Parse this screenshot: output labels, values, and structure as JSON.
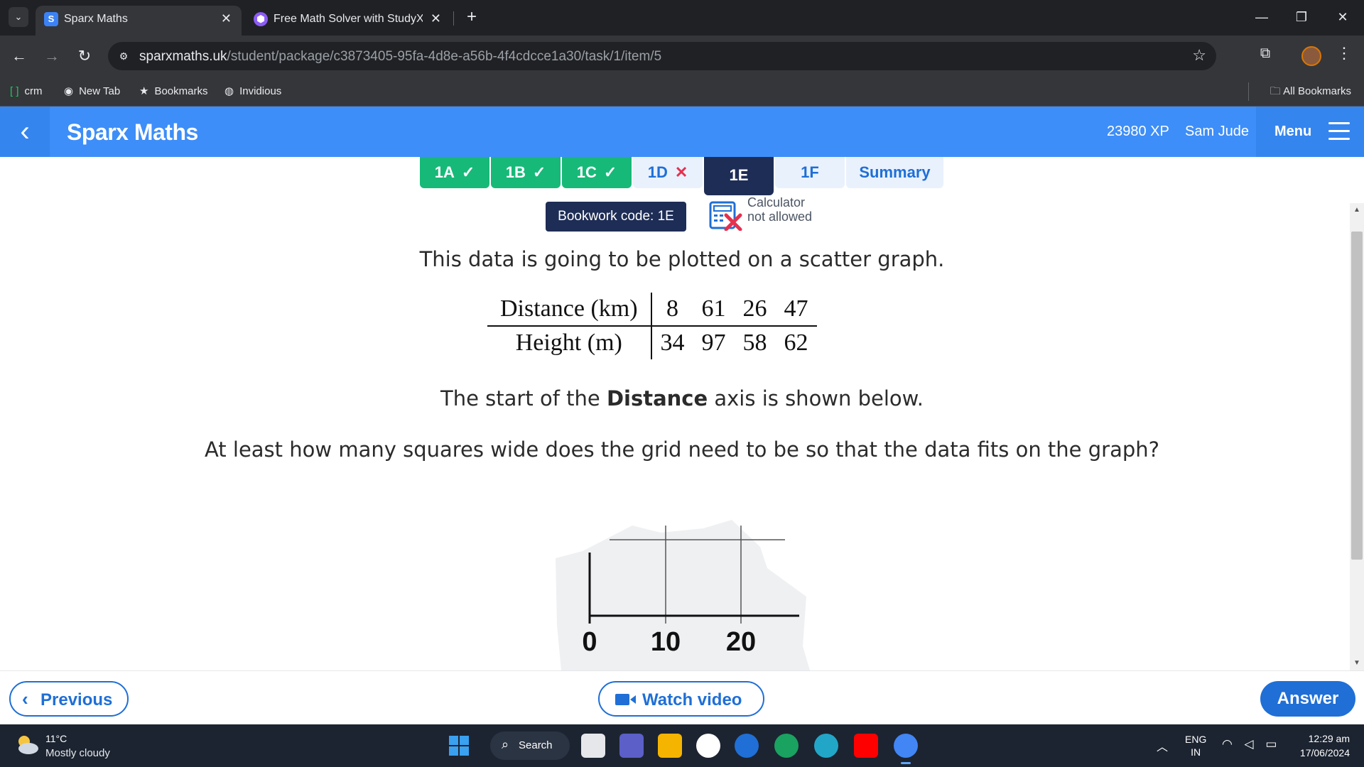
{
  "browser": {
    "tabs": [
      {
        "title": "Sparx Maths",
        "favicon": "S",
        "active": true
      },
      {
        "title": "Free Math Solver with StudyX M",
        "active": false
      }
    ],
    "url_host": "sparxmaths.uk",
    "url_path": "/student/package/c3873405-95fa-4d8e-a56b-4f4cdcce1a30/task/1/item/5",
    "bookmarks": [
      "crm",
      "New Tab",
      "Bookmarks",
      "Invidious"
    ],
    "all_bookmarks": "All Bookmarks"
  },
  "header": {
    "brand": "Sparx Maths",
    "xp": "23980 XP",
    "user": "Sam Jude",
    "menu": "Menu"
  },
  "task_tabs": [
    {
      "label": "1A",
      "status": "done",
      "mark": "✓"
    },
    {
      "label": "1B",
      "status": "done",
      "mark": "✓"
    },
    {
      "label": "1C",
      "status": "done",
      "mark": "✓"
    },
    {
      "label": "1D",
      "status": "wrong",
      "mark": "✕"
    },
    {
      "label": "1E",
      "status": "current",
      "mark": ""
    },
    {
      "label": "1F",
      "status": "todo",
      "mark": ""
    },
    {
      "label": "Summary",
      "status": "todo",
      "mark": ""
    }
  ],
  "question": {
    "bookwork": "Bookwork code: 1E",
    "calc_line1": "Calculator",
    "calc_line2": "not allowed",
    "intro": "This data is going to be plotted on a scatter graph.",
    "table": {
      "rows": [
        {
          "label": "Distance (km)",
          "values": [
            "8",
            "61",
            "26",
            "47"
          ]
        },
        {
          "label": "Height (m)",
          "values": [
            "34",
            "97",
            "58",
            "62"
          ]
        }
      ]
    },
    "axis_note_pre": "The start of the ",
    "axis_note_bold": "Distance",
    "axis_note_post": " axis is shown below.",
    "prompt": "At least how many squares wide does the grid need to be so that the data fits on the graph?",
    "axis_ticks": [
      "0",
      "10",
      "20"
    ]
  },
  "footer": {
    "previous": "Previous",
    "watch_video": "Watch video",
    "answer": "Answer"
  },
  "taskbar": {
    "temp": "11°C",
    "weather": "Mostly cloudy",
    "search": "Search",
    "lang1": "ENG",
    "lang2": "IN",
    "time": "12:29 am",
    "date": "17/06/2024"
  },
  "colors": {
    "sparx_blue": "#3d8ef8",
    "done_green": "#17b978",
    "current_navy": "#1e2d55",
    "wrong_red": "#e5304e",
    "link_blue": "#1f6fd6"
  }
}
